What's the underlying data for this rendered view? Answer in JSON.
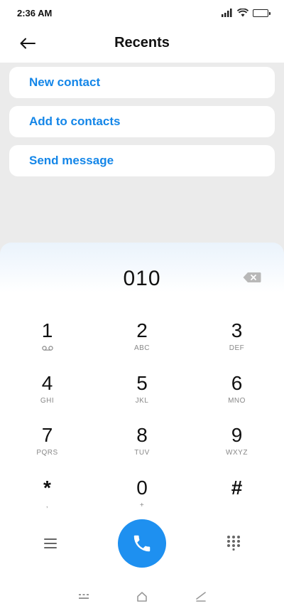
{
  "status_bar": {
    "time": "2:36 AM",
    "icons": [
      "signal-icon",
      "wifi-icon",
      "battery-icon"
    ]
  },
  "header": {
    "title": "Recents",
    "back_icon": "back-arrow-icon"
  },
  "actions": [
    {
      "label": "New contact"
    },
    {
      "label": "Add to contacts"
    },
    {
      "label": "Send message"
    }
  ],
  "dialer": {
    "number": "010",
    "keys": [
      {
        "digit": "1",
        "letters": ""
      },
      {
        "digit": "2",
        "letters": "ABC"
      },
      {
        "digit": "3",
        "letters": "DEF"
      },
      {
        "digit": "4",
        "letters": "GHI"
      },
      {
        "digit": "5",
        "letters": "JKL"
      },
      {
        "digit": "6",
        "letters": "MNO"
      },
      {
        "digit": "7",
        "letters": "PQRS"
      },
      {
        "digit": "8",
        "letters": "TUV"
      },
      {
        "digit": "9",
        "letters": "WXYZ"
      },
      {
        "digit": "*",
        "letters": ","
      },
      {
        "digit": "0",
        "letters": "+"
      },
      {
        "digit": "#",
        "letters": ""
      }
    ]
  },
  "colors": {
    "accent": "#1486e8",
    "call_button": "#1e90f0",
    "background": "#ebebeb"
  }
}
